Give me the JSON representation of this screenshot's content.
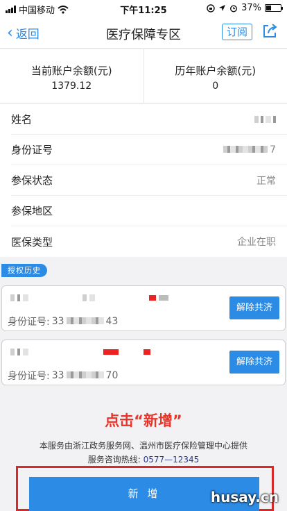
{
  "status_bar": {
    "carrier": "中国移动",
    "time": "下午11:25",
    "battery": "37%"
  },
  "nav": {
    "back_label": "返回",
    "title": "医疗保障专区",
    "subscribe_label": "订阅"
  },
  "balance": {
    "current_label": "当前账户余额(元)",
    "current_value": "1379.12",
    "history_label": "历年账户余额(元)",
    "history_value": "0"
  },
  "info": {
    "name_label": "姓名",
    "id_label": "身份证号",
    "id_suffix": "7",
    "status_label": "参保状态",
    "status_value": "正常",
    "region_label": "参保地区",
    "type_label": "医保类型",
    "type_value": "企业在职"
  },
  "history": {
    "tag": "授权历史",
    "cards": [
      {
        "id_label": "身份证号:",
        "id_prefix": "33",
        "id_suffix": "43",
        "button": "解除共济"
      },
      {
        "id_label": "身份证号:",
        "id_prefix": "33",
        "id_suffix": "70",
        "button": "解除共济"
      }
    ]
  },
  "hint": "点击“新增”",
  "footer": {
    "line1": "本服务由浙江政务服务网、温州市医疗保险管理中心提供",
    "line2_label": "服务咨询热线:",
    "phone": "0577—12345"
  },
  "add_button": "新 增",
  "watermark": "husay.cn",
  "colors": {
    "accent": "#2c8be5",
    "highlight": "#e8352c"
  }
}
